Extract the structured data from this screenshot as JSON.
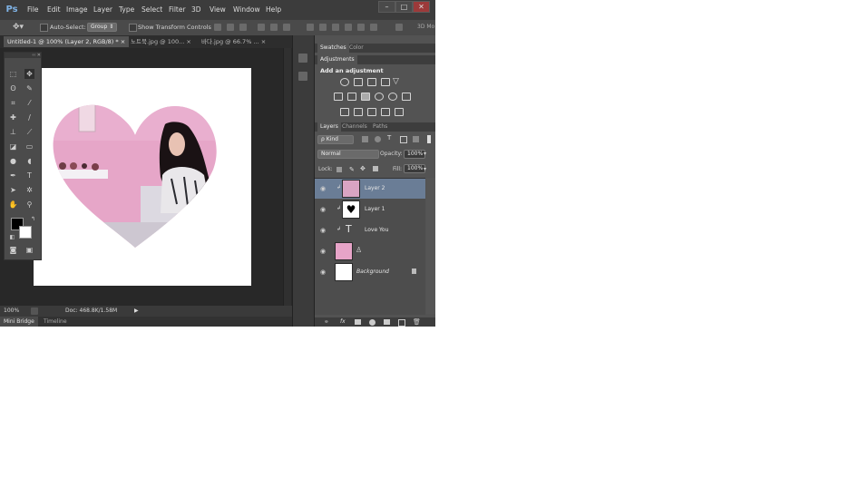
{
  "app": {
    "logo": "Ps"
  },
  "menu": [
    "File",
    "Edit",
    "Image",
    "Layer",
    "Type",
    "Select",
    "Filter",
    "3D",
    "View",
    "Window",
    "Help"
  ],
  "window_buttons": [
    "–",
    "□",
    "✕"
  ],
  "options": {
    "auto_select_label": "Auto-Select:",
    "auto_select_value": "Group",
    "show_transform_label": "Show Transform Controls",
    "mode_label": "3D Mo"
  },
  "doc_tabs": [
    {
      "label": "Untitled-1 @ 100% (Layer 2, RGB/8) *",
      "close": "×"
    },
    {
      "label": "노트북.jpg @ 100...",
      "close": "×"
    },
    {
      "label": "바다.jpg @ 66.7% ...",
      "close": "×"
    }
  ],
  "status": {
    "zoom": "100%",
    "doc": "Doc: 468.8K/1.58M",
    "arrow": "▶"
  },
  "bottom_tabs": [
    "Mini Bridge",
    "Timeline"
  ],
  "panels": {
    "swatches_tabs": [
      "Swatches",
      "Color"
    ],
    "adjustments_title": "Adjustments",
    "adjustments_subtitle": "Add an adjustment",
    "layers_tabs": [
      "Layers",
      "Channels",
      "Paths"
    ],
    "kind_label": "ρ Kind",
    "blend_mode": "Normal",
    "opacity_label": "Opacity:",
    "opacity_value": "100%",
    "lock_label": "Lock:",
    "fill_label": "Fill:",
    "fill_value": "100%",
    "layers": [
      {
        "name": "Layer 2",
        "selected": true
      },
      {
        "name": "Layer 1",
        "selected": false
      },
      {
        "name": "Love You",
        "selected": false
      },
      {
        "name": "",
        "selected": false
      },
      {
        "name": "Background",
        "selected": false
      }
    ],
    "text_layer_glyph": "T",
    "bottom_icons": [
      "link-icon",
      "fx-icon",
      "mask-icon",
      "adjustment-icon",
      "group-icon",
      "new-layer-icon",
      "trash-icon"
    ],
    "fx_label": "fx"
  },
  "colors": {
    "pink": "#e7a4c8",
    "selected_layer": "#6a7d96"
  }
}
